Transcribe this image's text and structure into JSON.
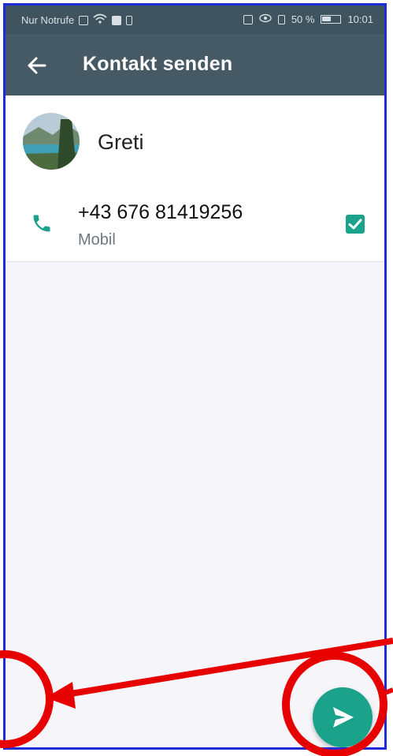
{
  "status_bar": {
    "carrier": "Nur Notrufe",
    "battery_percent": "50 %",
    "time": "10:01"
  },
  "app_bar": {
    "title": "Kontakt senden",
    "back_icon": "arrow-left-icon"
  },
  "contact": {
    "name": "Greti",
    "avatar_icon": "landscape-photo-avatar"
  },
  "phones": [
    {
      "number": "+43 676 81419256",
      "type": "Mobil",
      "checked": true,
      "icon": "phone-icon"
    }
  ],
  "fab": {
    "icon": "send-icon"
  },
  "colors": {
    "appbar": "#455a64",
    "statusbar": "#3f545e",
    "accent": "#1aa38a",
    "annotation_red": "#e60000",
    "frame_blue": "#1f2bd6"
  }
}
